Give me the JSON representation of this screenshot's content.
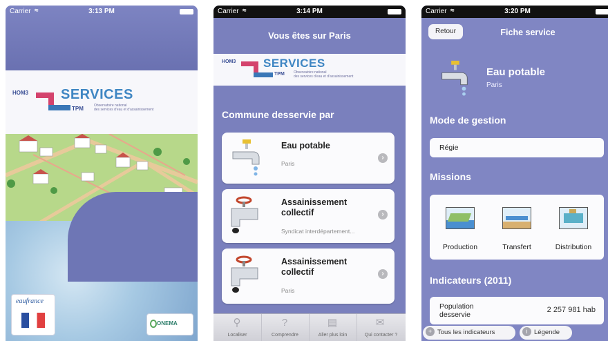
{
  "screen1": {
    "status": {
      "carrier": "Carrier",
      "time": "3:13 PM"
    },
    "logo": {
      "word": "SERVICES",
      "grid_top": "HOM3",
      "grid_bottom": "TPM",
      "subtitle_1": "Observatoire national",
      "subtitle_2": "des services d'eau et d'assainissement"
    },
    "badge_left": {
      "name": "eaufrance"
    },
    "badge_right": {
      "name": "ONEMA"
    }
  },
  "screen2": {
    "status": {
      "carrier": "Carrier",
      "time": "3:14 PM"
    },
    "nav_title": "Vous êtes sur Paris",
    "logo": {
      "word": "SERVICES",
      "grid_top": "HOM3",
      "grid_bottom": "TPM",
      "subtitle_1": "Observatoire national",
      "subtitle_2": "des services d'eau et d'assainissement"
    },
    "section_title": "Commune desservie par",
    "services": [
      {
        "title": "Eau potable",
        "subtitle": "Paris",
        "icon": "water-tap-icon"
      },
      {
        "title": "Assainissement collectif",
        "subtitle": "Syndicat interdépartement...",
        "icon": "drain-pipe-icon"
      },
      {
        "title": "Assainissement collectif",
        "subtitle": "Paris",
        "icon": "drain-pipe-icon"
      }
    ],
    "tabs": [
      {
        "label": "Localiser",
        "icon": "search-icon"
      },
      {
        "label": "Comprendre",
        "icon": "question-icon"
      },
      {
        "label": "Aller plus loin",
        "icon": "document-icon"
      },
      {
        "label": "Qui contacter ?",
        "icon": "mail-icon"
      }
    ]
  },
  "screen3": {
    "status": {
      "carrier": "Carrier",
      "time": "3:20 PM"
    },
    "back_label": "Retour",
    "nav_title": "Fiche service",
    "service_name": "Eau potable",
    "service_city": "Paris",
    "mode_title": "Mode de gestion",
    "mode_value": "Régie",
    "missions_title": "Missions",
    "missions": [
      {
        "label": "Production",
        "icon": "production-icon"
      },
      {
        "label": "Transfert",
        "icon": "transfer-icon"
      },
      {
        "label": "Distribution",
        "icon": "distribution-icon"
      }
    ],
    "indicators_title": "Indicateurs (2011)",
    "indicator": {
      "label": "Population desservie",
      "value": "2 257 981 hab"
    },
    "button_all": "Tous les indicateurs",
    "button_legend": "Légende"
  },
  "colors": {
    "accent": "#7a80bd",
    "brand_blue": "#3f86c3",
    "brand_red": "#d4436d"
  }
}
